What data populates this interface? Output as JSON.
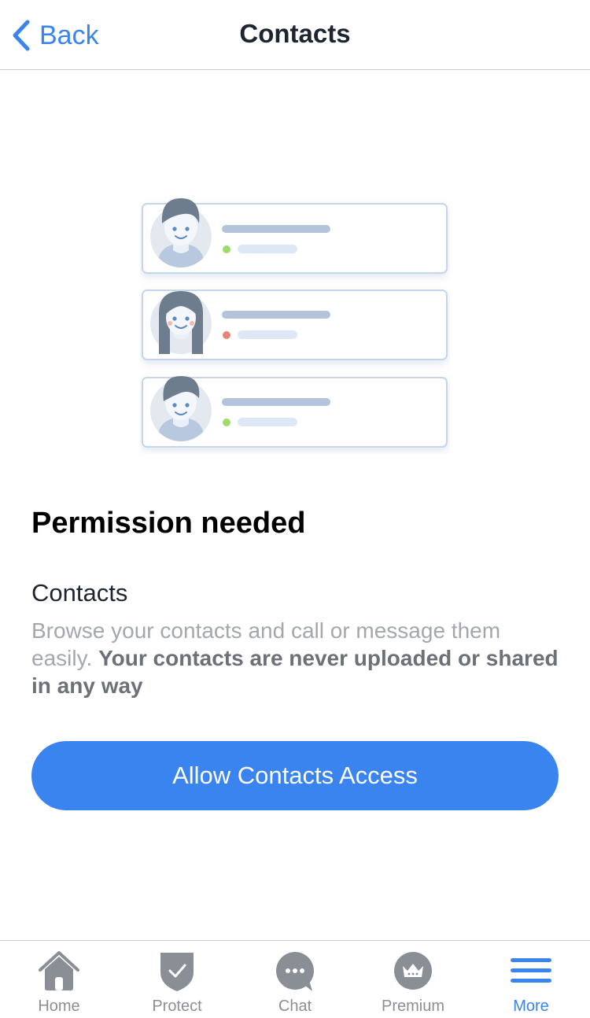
{
  "nav": {
    "back_label": "Back",
    "title": "Contacts"
  },
  "permission": {
    "title": "Permission needed",
    "subtitle": "Contacts",
    "desc_plain": "Browse your contacts and call or message them easily. ",
    "desc_strong": "Your contacts are never uploaded or shared in any way",
    "button_label": "Allow Contacts Access"
  },
  "tabs": [
    {
      "label": "Home",
      "icon": "home-icon",
      "active": false
    },
    {
      "label": "Protect",
      "icon": "shield-icon",
      "active": false
    },
    {
      "label": "Chat",
      "icon": "chat-icon",
      "active": false
    },
    {
      "label": "Premium",
      "icon": "crown-icon",
      "active": false
    },
    {
      "label": "More",
      "icon": "menu-icon",
      "active": true
    }
  ],
  "colors": {
    "accent": "#3a84f0",
    "inactive_tab": "#8a8f96",
    "status_online": "#9ddb6b",
    "status_busy": "#e8837a"
  }
}
